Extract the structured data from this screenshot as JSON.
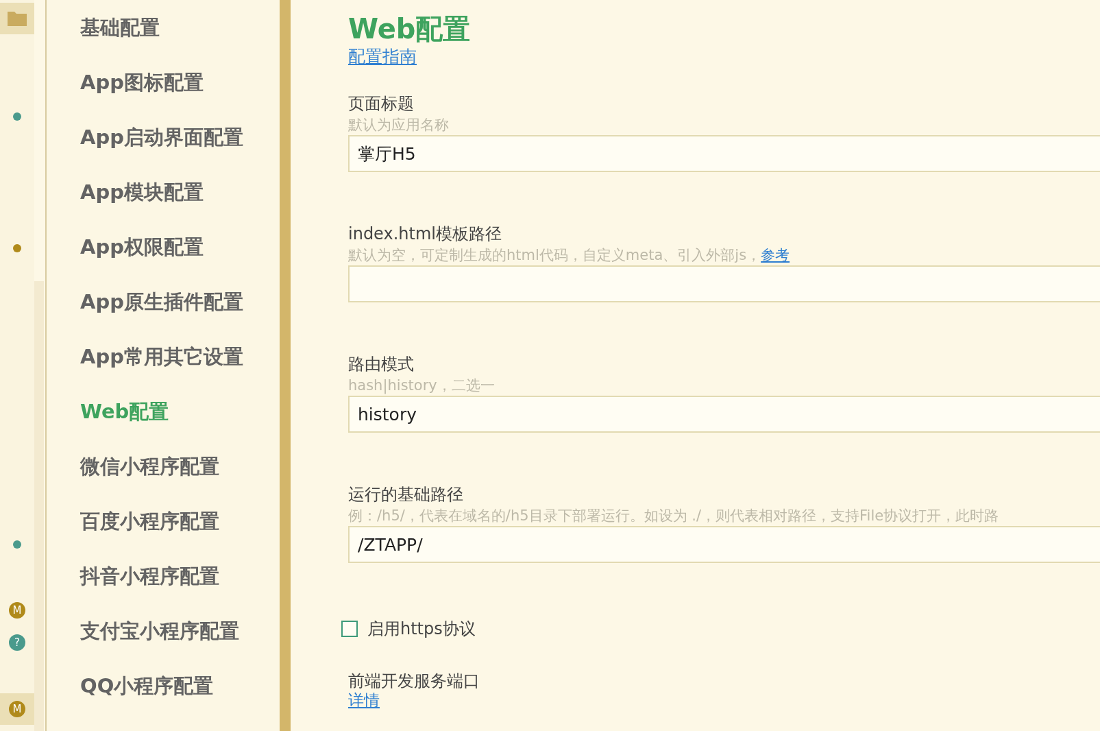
{
  "markers": [
    {
      "kind": "folder",
      "highlighted": true
    },
    {
      "kind": "dot",
      "color": "#4a9a8c",
      "highlighted": false
    },
    {
      "kind": "dot",
      "color": "#b08a1a",
      "highlighted": false
    },
    {
      "kind": "dot",
      "color": "#4a9a8c",
      "highlighted": false
    },
    {
      "kind": "badge",
      "text": "M",
      "color": "#b08a1a",
      "highlighted": false
    },
    {
      "kind": "badge",
      "text": "?",
      "color": "#4a9a8c",
      "highlighted": false
    },
    {
      "kind": "badge",
      "text": "M",
      "color": "#b08a1a",
      "highlighted": true
    }
  ],
  "nav": {
    "items": [
      {
        "label": "基础配置",
        "selected": false
      },
      {
        "label": "App图标配置",
        "selected": false
      },
      {
        "label": "App启动界面配置",
        "selected": false
      },
      {
        "label": "App模块配置",
        "selected": false
      },
      {
        "label": "App权限配置",
        "selected": false
      },
      {
        "label": "App原生插件配置",
        "selected": false
      },
      {
        "label": "App常用其它设置",
        "selected": false
      },
      {
        "label": "Web配置",
        "selected": true
      },
      {
        "label": "微信小程序配置",
        "selected": false
      },
      {
        "label": "百度小程序配置",
        "selected": false
      },
      {
        "label": "抖音小程序配置",
        "selected": false
      },
      {
        "label": "支付宝小程序配置",
        "selected": false
      },
      {
        "label": "QQ小程序配置",
        "selected": false
      }
    ]
  },
  "page": {
    "title": "Web配置",
    "guide_link": "配置指南"
  },
  "fields": [
    {
      "kind": "text",
      "label": "页面标题",
      "hint": "默认为应用名称",
      "value": "掌厅H5"
    },
    {
      "kind": "text",
      "label": "index.html模板路径",
      "hint": "默认为空，可定制生成的html代码，自定义meta、引入外部js，",
      "hint_link": "参考"
    },
    {
      "kind": "text",
      "label": "路由模式",
      "hint": "hash|history，二选一",
      "value": "history"
    },
    {
      "kind": "text",
      "label": "运行的基础路径",
      "hint": "例：/h5/，代表在域名的/h5目录下部署运行。如设为 ./，则代表相对路径，支持File协议打开，此时路",
      "value": "/ZTAPP/"
    },
    {
      "kind": "checkbox",
      "label": "启用https协议",
      "checked": false
    },
    {
      "kind": "heading",
      "label": "前端开发服务端口",
      "link": "详情"
    }
  ]
}
